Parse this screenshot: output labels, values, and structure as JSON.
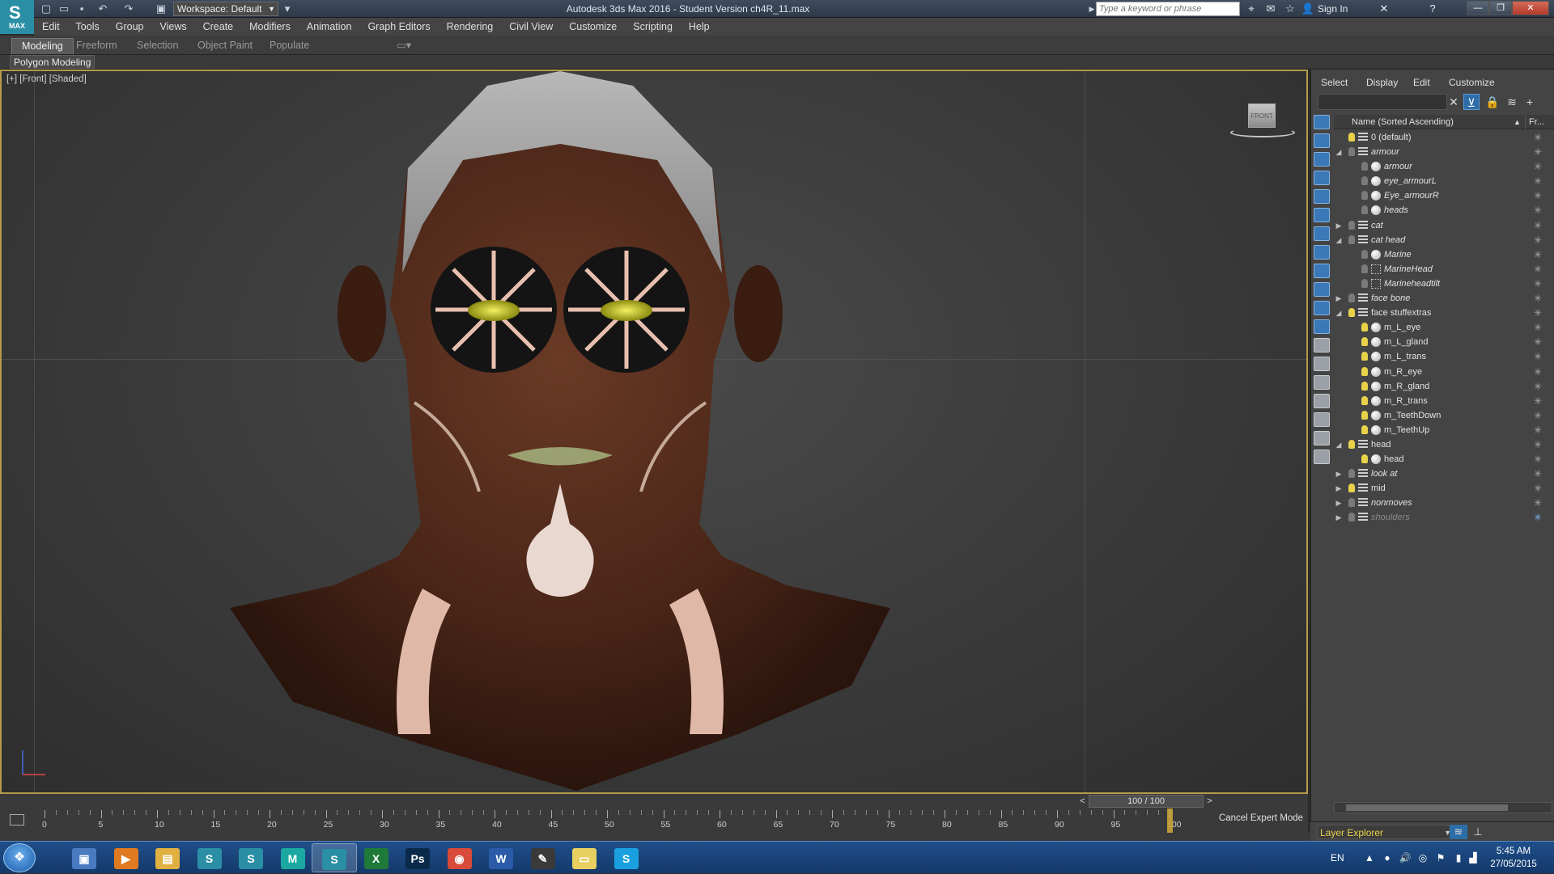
{
  "app": {
    "logo_text": "MAX",
    "window_title": "Autodesk 3ds Max 2016 - Student Version    ch4R_11.max",
    "workspace": "Workspace: Default"
  },
  "header": {
    "search_placeholder": "Type a keyword or phrase",
    "sign_in": "Sign In"
  },
  "menu": [
    "Edit",
    "Tools",
    "Group",
    "Views",
    "Create",
    "Modifiers",
    "Animation",
    "Graph Editors",
    "Rendering",
    "Civil View",
    "Customize",
    "Scripting",
    "Help"
  ],
  "ribbon": {
    "tabs": [
      "Modeling",
      "Freeform",
      "Selection",
      "Object Paint",
      "Populate"
    ],
    "active_tab": "Modeling",
    "panel_label": "Polygon Modeling"
  },
  "viewport": {
    "label": "[+] [Front] [Shaded]",
    "viewcube_label": "FRONT"
  },
  "scene_explorer": {
    "tabs": [
      "Select",
      "Display",
      "Edit",
      "Customize"
    ],
    "column_name": "Name (Sorted Ascending)",
    "column_freeze": "Fr...",
    "rows": [
      {
        "label": "0 (default)",
        "level": 0,
        "expand": "",
        "icon": "layer",
        "light": "on",
        "italic": false
      },
      {
        "label": "armour",
        "level": 0,
        "expand": "open",
        "icon": "layer",
        "light": "off",
        "italic": true
      },
      {
        "label": "armour",
        "level": 1,
        "expand": "",
        "icon": "sphere",
        "light": "off",
        "italic": true
      },
      {
        "label": "eye_armourL",
        "level": 1,
        "expand": "",
        "icon": "sphere",
        "light": "off",
        "italic": true
      },
      {
        "label": "Eye_armourR",
        "level": 1,
        "expand": "",
        "icon": "sphere",
        "light": "off",
        "italic": true
      },
      {
        "label": "heads",
        "level": 1,
        "expand": "",
        "icon": "sphere",
        "light": "off",
        "italic": true
      },
      {
        "label": "cat",
        "level": 0,
        "expand": "closed",
        "icon": "layer",
        "light": "off",
        "italic": true
      },
      {
        "label": "cat head",
        "level": 0,
        "expand": "open",
        "icon": "layer",
        "light": "off",
        "italic": true
      },
      {
        "label": "Marine",
        "level": 1,
        "expand": "",
        "icon": "sphere",
        "light": "off",
        "italic": true
      },
      {
        "label": "MarineHead",
        "level": 1,
        "expand": "",
        "icon": "dots",
        "light": "off",
        "italic": true
      },
      {
        "label": "Marineheadtilt",
        "level": 1,
        "expand": "",
        "icon": "dots",
        "light": "off",
        "italic": true
      },
      {
        "label": "face bone",
        "level": 0,
        "expand": "closed",
        "icon": "layer",
        "light": "off",
        "italic": true
      },
      {
        "label": "face stuffextras",
        "level": 0,
        "expand": "open",
        "icon": "layer",
        "light": "on",
        "italic": false
      },
      {
        "label": "m_L_eye",
        "level": 1,
        "expand": "",
        "icon": "sphere",
        "light": "on",
        "italic": false
      },
      {
        "label": "m_L_gland",
        "level": 1,
        "expand": "",
        "icon": "sphere",
        "light": "on",
        "italic": false
      },
      {
        "label": "m_L_trans",
        "level": 1,
        "expand": "",
        "icon": "sphere",
        "light": "on",
        "italic": false
      },
      {
        "label": "m_R_eye",
        "level": 1,
        "expand": "",
        "icon": "sphere",
        "light": "on",
        "italic": false
      },
      {
        "label": "m_R_gland",
        "level": 1,
        "expand": "",
        "icon": "sphere",
        "light": "on",
        "italic": false
      },
      {
        "label": "m_R_trans",
        "level": 1,
        "expand": "",
        "icon": "sphere",
        "light": "on",
        "italic": false
      },
      {
        "label": "m_TeethDown",
        "level": 1,
        "expand": "",
        "icon": "sphere",
        "light": "on",
        "italic": false
      },
      {
        "label": "m_TeethUp",
        "level": 1,
        "expand": "",
        "icon": "sphere",
        "light": "on",
        "italic": false
      },
      {
        "label": "head",
        "level": 0,
        "expand": "open",
        "icon": "layer",
        "light": "on",
        "italic": false
      },
      {
        "label": "head",
        "level": 1,
        "expand": "",
        "icon": "sphere",
        "light": "on",
        "italic": false
      },
      {
        "label": "look at",
        "level": 0,
        "expand": "closed",
        "icon": "layer",
        "light": "off",
        "italic": true
      },
      {
        "label": "mid",
        "level": 0,
        "expand": "closed",
        "icon": "layer",
        "light": "on",
        "italic": false
      },
      {
        "label": "nonmoves",
        "level": 0,
        "expand": "closed",
        "icon": "layer",
        "light": "off",
        "italic": true
      },
      {
        "label": "shoulders",
        "level": 0,
        "expand": "closed",
        "icon": "layer",
        "light": "off",
        "italic": true,
        "dim": true
      }
    ]
  },
  "timeline": {
    "frame_counter": "100 / 100",
    "prev": "<",
    "next": ">",
    "current_frame": 100,
    "ticks": [
      "0",
      "5",
      "10",
      "15",
      "20",
      "25",
      "30",
      "35",
      "40",
      "45",
      "50",
      "55",
      "60",
      "65",
      "70",
      "75",
      "80",
      "85",
      "90",
      "95",
      "100"
    ],
    "cancel_expert": "Cancel Expert Mode"
  },
  "layer_explorer": {
    "label": "Layer Explorer"
  },
  "taskbar": {
    "apps": [
      {
        "name": "computer",
        "glyph": "▣",
        "color": "#4a7ac0"
      },
      {
        "name": "media-player",
        "glyph": "▶",
        "color": "#e07a20"
      },
      {
        "name": "explorer",
        "glyph": "▤",
        "color": "#e0b040"
      },
      {
        "name": "3dsmax-a",
        "glyph": "S",
        "color": "#2a8fa5"
      },
      {
        "name": "3dsmax-b",
        "glyph": "S",
        "color": "#2a8fa5"
      },
      {
        "name": "maya",
        "glyph": "M",
        "color": "#1aa8a0"
      },
      {
        "name": "3dsmax-active",
        "glyph": "S",
        "color": "#2a8fa5",
        "active": true
      },
      {
        "name": "excel",
        "glyph": "X",
        "color": "#1f7a3a"
      },
      {
        "name": "photoshop",
        "glyph": "Ps",
        "color": "#0a2a4a"
      },
      {
        "name": "chrome",
        "glyph": "◉",
        "color": "#d84a3a"
      },
      {
        "name": "word",
        "glyph": "W",
        "color": "#2a5aa8"
      },
      {
        "name": "tool",
        "glyph": "✎",
        "color": "#3a3a3a"
      },
      {
        "name": "notes",
        "glyph": "▭",
        "color": "#e8d060"
      },
      {
        "name": "skype",
        "glyph": "S",
        "color": "#1aa0e0"
      }
    ],
    "lang": "EN",
    "time": "5:45 AM",
    "date": "27/05/2015"
  },
  "colors": {
    "accent": "#b49a4a",
    "selected": "#2d6da8",
    "bulb_on": "#e8d24a"
  }
}
